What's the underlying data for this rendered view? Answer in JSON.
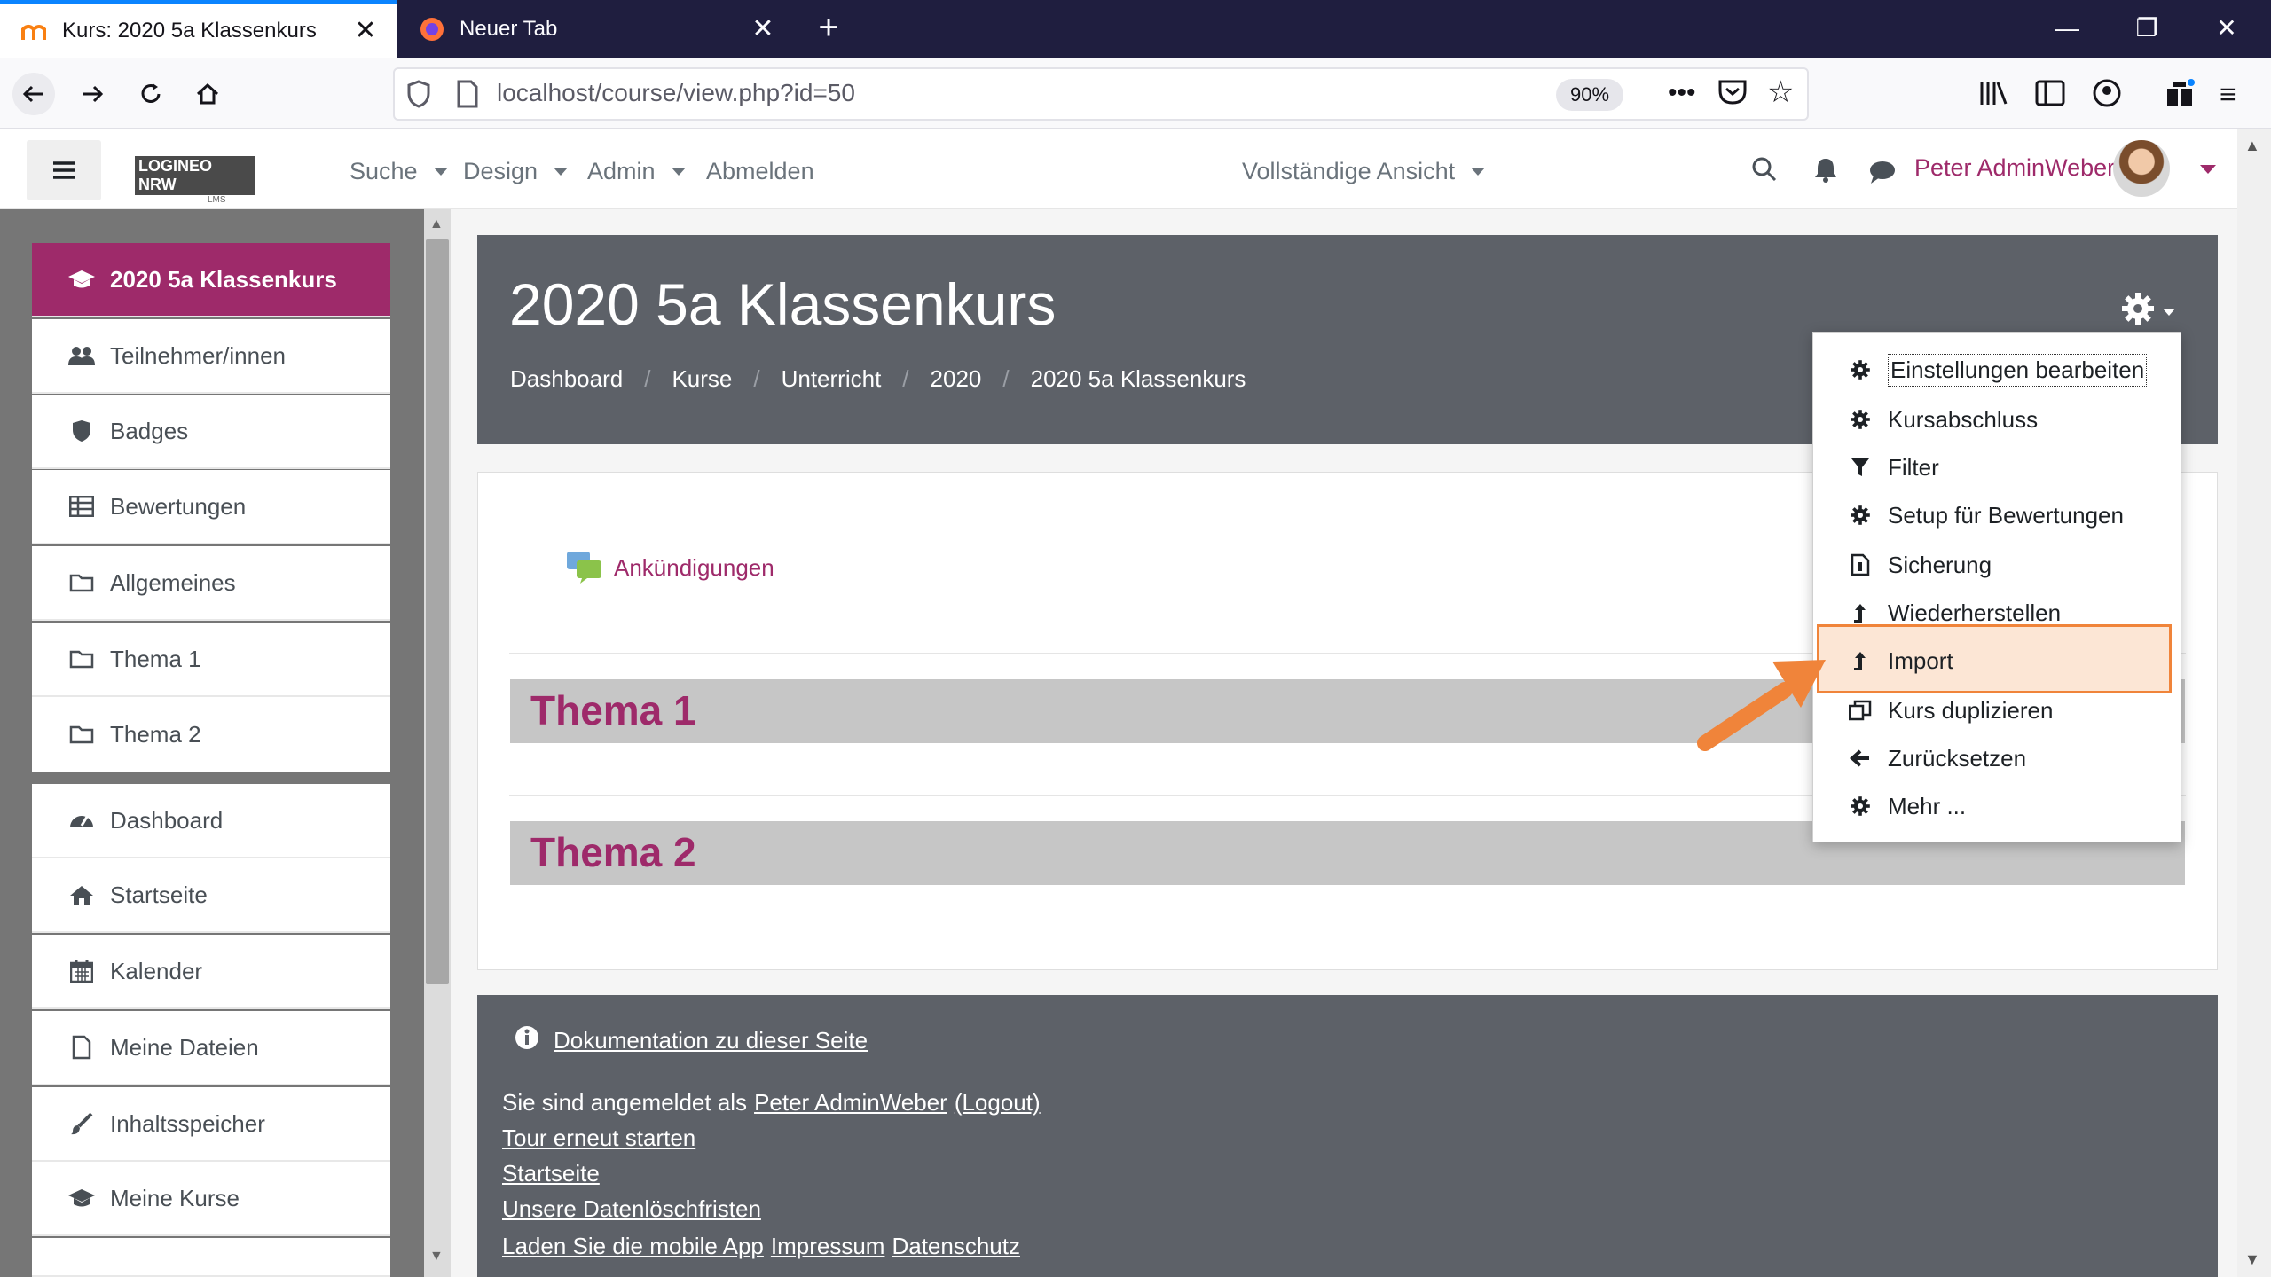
{
  "browser": {
    "tabs": [
      {
        "title": "Kurs: 2020 5a Klassenkurs",
        "active": true
      },
      {
        "title": "Neuer Tab",
        "active": false
      }
    ],
    "url": "localhost/course/view.php?id=50",
    "zoom": "90%"
  },
  "header": {
    "logo_text": "LOGINEO NRW",
    "logo_sub": "LMS",
    "menu": [
      "Suche",
      "Design",
      "Admin",
      "Abmelden"
    ],
    "view_mode": "Vollständige Ansicht",
    "user_name": "Peter AdminWeber"
  },
  "drawer": {
    "course_items": [
      {
        "label": "2020 5a Klassenkurs",
        "icon": "graduation-cap-icon",
        "active": true
      },
      {
        "label": "Teilnehmer/innen",
        "icon": "users-icon"
      },
      {
        "label": "Badges",
        "icon": "shield-icon"
      },
      {
        "label": "Bewertungen",
        "icon": "table-icon"
      },
      {
        "label": "Allgemeines",
        "icon": "folder-icon"
      },
      {
        "label": "Thema 1",
        "icon": "folder-icon"
      },
      {
        "label": "Thema 2",
        "icon": "folder-icon"
      }
    ],
    "site_items": [
      {
        "label": "Dashboard",
        "icon": "dashboard-icon"
      },
      {
        "label": "Startseite",
        "icon": "home-icon"
      },
      {
        "label": "Kalender",
        "icon": "calendar-icon"
      },
      {
        "label": "Meine Dateien",
        "icon": "file-icon"
      },
      {
        "label": "Inhaltsspeicher",
        "icon": "brush-icon"
      },
      {
        "label": "Meine Kurse",
        "icon": "graduation-cap-icon"
      }
    ]
  },
  "course": {
    "title": "2020 5a Klassenkurs",
    "breadcrumb": [
      "Dashboard",
      "Kurse",
      "Unterricht",
      "2020",
      "2020 5a Klassenkurs"
    ],
    "forum_label": "Ankündigungen",
    "sections": [
      "Thema 1",
      "Thema 2"
    ]
  },
  "admin_menu": {
    "items": [
      {
        "label": "Einstellungen bearbeiten",
        "icon": "gear-icon"
      },
      {
        "label": "Kursabschluss",
        "icon": "gear-icon"
      },
      {
        "label": "Filter",
        "icon": "filter-icon"
      },
      {
        "label": "Setup für Bewertungen",
        "icon": "gear-icon"
      },
      {
        "label": "Sicherung",
        "icon": "backup-file-icon"
      },
      {
        "label": "Wiederherstellen",
        "icon": "upload-arrow-icon"
      },
      {
        "label": "Import",
        "icon": "upload-arrow-icon",
        "highlighted": true
      },
      {
        "label": "Kurs duplizieren",
        "icon": "copy-icon"
      },
      {
        "label": "Zurücksetzen",
        "icon": "arrow-left-icon"
      },
      {
        "label": "Mehr ...",
        "icon": "gear-icon"
      }
    ]
  },
  "footer": {
    "doc_link": "Dokumentation zu dieser Seite",
    "logged_in_prefix": "Sie sind angemeldet als",
    "logged_in_user": "Peter AdminWeber",
    "logout": "(Logout)",
    "links": [
      "Tour erneut starten",
      "Startseite",
      "Unsere Datenlöschfristen"
    ],
    "bottom_links": [
      "Laden Sie die mobile App",
      "Impressum",
      "Datenschutz"
    ]
  },
  "colors": {
    "brand": "#9e2a6a",
    "header_gray": "#5d6168",
    "highlight_orange": "#f0843a"
  }
}
